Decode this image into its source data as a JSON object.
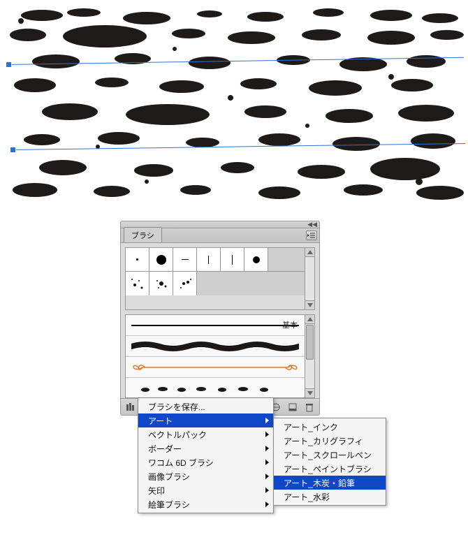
{
  "panel": {
    "tab_label": "ブラシ",
    "basic_label": "基本",
    "footer_icons": [
      "library-icon",
      "library-folder-icon",
      "cancel-icon",
      "stroke-icon",
      "new-icon",
      "trash-icon"
    ]
  },
  "thumbs": [
    {
      "label": "dot-small"
    },
    {
      "label": "dot-large"
    },
    {
      "label": "thin-line"
    },
    {
      "label": "thin-vertical"
    },
    {
      "label": "thin-vertical-2"
    },
    {
      "label": "dot-medium"
    },
    {
      "label": "splatter-1"
    },
    {
      "label": "splatter-2"
    },
    {
      "label": "splatter-3"
    }
  ],
  "strokes": [
    {
      "kind": "basic-line"
    },
    {
      "kind": "charcoal"
    },
    {
      "kind": "calligraphic-loop"
    },
    {
      "kind": "dots"
    }
  ],
  "menu_main": [
    {
      "label": "ブラシを保存...",
      "sub": false
    },
    {
      "label": "アート",
      "sub": true,
      "hi": true
    },
    {
      "label": "ベクトルパック",
      "sub": true
    },
    {
      "label": "ボーダー",
      "sub": true
    },
    {
      "label": "ワコム 6D ブラシ",
      "sub": true
    },
    {
      "label": "画像ブラシ",
      "sub": true
    },
    {
      "label": "矢印",
      "sub": true
    },
    {
      "label": "絵筆ブラシ",
      "sub": true
    }
  ],
  "menu_sub": [
    {
      "label": "アート_インク"
    },
    {
      "label": "アート_カリグラフィ"
    },
    {
      "label": "アート_スクロールペン"
    },
    {
      "label": "アート_ペイントブラシ"
    },
    {
      "label": "アート_木炭・鉛筆",
      "hi": true
    },
    {
      "label": "アート_水彩"
    }
  ]
}
